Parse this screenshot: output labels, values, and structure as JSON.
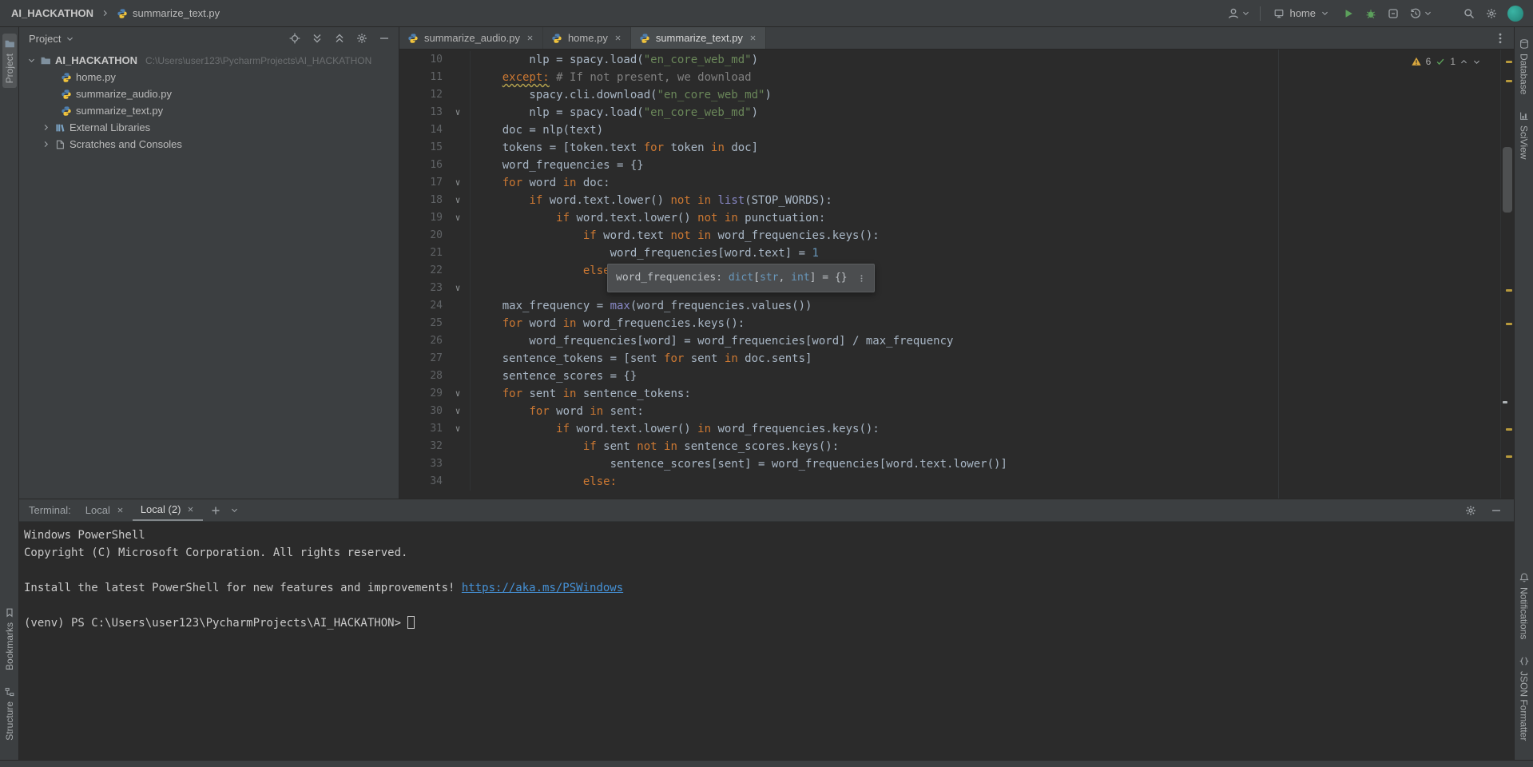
{
  "theme": {
    "editor_bg": "#2b2b2b",
    "panel_bg": "#3c3f41",
    "border": "#282828",
    "ui_text": "#bbbbbb",
    "code_text": "#a9b7c6",
    "keyword_orange": "#cc7832",
    "string_green": "#6a8759",
    "number_blue": "#6897bb",
    "comment_gray": "#808080",
    "builtin_purple": "#8888c6",
    "line_number_gray": "#606366",
    "run_green": "#5ca05c",
    "warning_yellow": "#d9a73e",
    "link_blue": "#4591d6",
    "avatar_teal": "#2e9e92"
  },
  "titlebar": {
    "project": "AI_HACKATHON",
    "file": "summarize_text.py",
    "run_config": "home"
  },
  "tool_strips": {
    "left_top": [
      "Project"
    ],
    "left_bottom": [
      "Bookmarks",
      "Structure"
    ],
    "right_top": [
      "Database",
      "SciView"
    ],
    "right_bottom": [
      "Notifications",
      "JSON Formatter"
    ]
  },
  "project_panel": {
    "header": "Project",
    "root_name": "AI_HACKATHON",
    "root_path": "C:\\Users\\user123\\PycharmProjects\\AI_HACKATHON",
    "files": [
      "home.py",
      "summarize_audio.py",
      "summarize_text.py"
    ],
    "nodes": [
      "External Libraries",
      "Scratches and Consoles"
    ]
  },
  "editor_tabs": [
    {
      "label": "summarize_audio.py"
    },
    {
      "label": "home.py"
    },
    {
      "label": "summarize_text.py"
    }
  ],
  "inspections": {
    "warnings": "6",
    "typos": "1"
  },
  "editor": {
    "tooltip": {
      "seg": [
        {
          "t": "word_frequencies: ",
          "c": "tp"
        },
        {
          "t": "dict",
          "c": "tb"
        },
        {
          "t": "[",
          "c": "tp"
        },
        {
          "t": "str",
          "c": "tb"
        },
        {
          "t": ", ",
          "c": "tp"
        },
        {
          "t": "int",
          "c": "tb"
        },
        {
          "t": "] = {}",
          "c": "tp"
        }
      ]
    },
    "lines": [
      {
        "no": "10",
        "fold": false,
        "seg": [
          {
            "t": "        nlp = spacy.load(",
            "c": "p"
          },
          {
            "t": "\"en_core_web_md\"",
            "c": "s"
          },
          {
            "t": ")",
            "c": "p"
          }
        ]
      },
      {
        "no": "11",
        "fold": false,
        "seg": [
          {
            "t": "    ",
            "c": "p"
          },
          {
            "t": "except:",
            "c": "e"
          },
          {
            "t": " ",
            "c": "p"
          },
          {
            "t": "# If not present, we download",
            "c": "c"
          }
        ]
      },
      {
        "no": "12",
        "fold": false,
        "seg": [
          {
            "t": "        spacy.cli.download(",
            "c": "p"
          },
          {
            "t": "\"en_core_web_md\"",
            "c": "s"
          },
          {
            "t": ")",
            "c": "p"
          }
        ]
      },
      {
        "no": "13",
        "fold": true,
        "seg": [
          {
            "t": "        nlp = spacy.load(",
            "c": "p"
          },
          {
            "t": "\"en_core_web_md\"",
            "c": "s"
          },
          {
            "t": ")",
            "c": "p"
          }
        ]
      },
      {
        "no": "14",
        "fold": false,
        "seg": [
          {
            "t": "    doc = nlp(text)",
            "c": "p"
          }
        ]
      },
      {
        "no": "15",
        "fold": false,
        "seg": [
          {
            "t": "    tokens = [token.text ",
            "c": "p"
          },
          {
            "t": "for",
            "c": "k"
          },
          {
            "t": " token ",
            "c": "p"
          },
          {
            "t": "in",
            "c": "k"
          },
          {
            "t": " doc]",
            "c": "p"
          }
        ]
      },
      {
        "no": "16",
        "fold": false,
        "seg": [
          {
            "t": "    word_frequencies = {}",
            "c": "p"
          }
        ]
      },
      {
        "no": "17",
        "fold": true,
        "seg": [
          {
            "t": "    ",
            "c": "p"
          },
          {
            "t": "for",
            "c": "k"
          },
          {
            "t": " word ",
            "c": "p"
          },
          {
            "t": "in",
            "c": "k"
          },
          {
            "t": " doc:",
            "c": "p"
          }
        ]
      },
      {
        "no": "18",
        "fold": true,
        "seg": [
          {
            "t": "        ",
            "c": "p"
          },
          {
            "t": "if",
            "c": "k"
          },
          {
            "t": " word.text.lower() ",
            "c": "p"
          },
          {
            "t": "not in",
            "c": "k"
          },
          {
            "t": " ",
            "c": "p"
          },
          {
            "t": "list",
            "c": "b"
          },
          {
            "t": "(STOP_WORDS):",
            "c": "p"
          }
        ]
      },
      {
        "no": "19",
        "fold": true,
        "seg": [
          {
            "t": "            ",
            "c": "p"
          },
          {
            "t": "if",
            "c": "k"
          },
          {
            "t": " word.text.lower() ",
            "c": "p"
          },
          {
            "t": "not in",
            "c": "k"
          },
          {
            "t": " punctuation:",
            "c": "p"
          }
        ]
      },
      {
        "no": "20",
        "fold": false,
        "seg": [
          {
            "t": "                ",
            "c": "p"
          },
          {
            "t": "if",
            "c": "k"
          },
          {
            "t": " word.text ",
            "c": "p"
          },
          {
            "t": "not in",
            "c": "k"
          },
          {
            "t": " word_frequencies.keys():",
            "c": "p"
          }
        ]
      },
      {
        "no": "21",
        "fold": false,
        "seg": [
          {
            "t": "                    word_frequencies[word.text] = ",
            "c": "p"
          },
          {
            "t": "1",
            "c": "n"
          }
        ]
      },
      {
        "no": "22",
        "fold": false,
        "seg": [
          {
            "t": "                ",
            "c": "p"
          },
          {
            "t": "else",
            "c": "k"
          }
        ]
      },
      {
        "no": "23",
        "fold": true,
        "seg": []
      },
      {
        "no": "24",
        "fold": false,
        "seg": [
          {
            "t": "    max_frequency = ",
            "c": "p"
          },
          {
            "t": "max",
            "c": "b"
          },
          {
            "t": "(word_frequencies.values())",
            "c": "p"
          }
        ]
      },
      {
        "no": "25",
        "fold": false,
        "seg": [
          {
            "t": "    ",
            "c": "p"
          },
          {
            "t": "for",
            "c": "k"
          },
          {
            "t": " word ",
            "c": "p"
          },
          {
            "t": "in",
            "c": "k"
          },
          {
            "t": " word_frequencies.keys():",
            "c": "p"
          }
        ]
      },
      {
        "no": "26",
        "fold": false,
        "seg": [
          {
            "t": "        word_frequencies[word] = word_frequencies[word] / max_frequency",
            "c": "p"
          }
        ]
      },
      {
        "no": "27",
        "fold": false,
        "seg": [
          {
            "t": "    sentence_tokens = [sent ",
            "c": "p"
          },
          {
            "t": "for",
            "c": "k"
          },
          {
            "t": " sent ",
            "c": "p"
          },
          {
            "t": "in",
            "c": "k"
          },
          {
            "t": " doc.sents]",
            "c": "p"
          }
        ]
      },
      {
        "no": "28",
        "fold": false,
        "seg": [
          {
            "t": "    sentence_scores = {}",
            "c": "p"
          }
        ]
      },
      {
        "no": "29",
        "fold": true,
        "seg": [
          {
            "t": "    ",
            "c": "p"
          },
          {
            "t": "for",
            "c": "k"
          },
          {
            "t": " sent ",
            "c": "p"
          },
          {
            "t": "in",
            "c": "k"
          },
          {
            "t": " sentence_tokens:",
            "c": "p"
          }
        ]
      },
      {
        "no": "30",
        "fold": true,
        "seg": [
          {
            "t": "        ",
            "c": "p"
          },
          {
            "t": "for",
            "c": "k"
          },
          {
            "t": " word ",
            "c": "p"
          },
          {
            "t": "in",
            "c": "k"
          },
          {
            "t": " sent:",
            "c": "p"
          }
        ]
      },
      {
        "no": "31",
        "fold": true,
        "seg": [
          {
            "t": "            ",
            "c": "p"
          },
          {
            "t": "if",
            "c": "k"
          },
          {
            "t": " word.text.lower() ",
            "c": "p"
          },
          {
            "t": "in",
            "c": "k"
          },
          {
            "t": " word_frequencies.keys():",
            "c": "p"
          }
        ]
      },
      {
        "no": "32",
        "fold": false,
        "seg": [
          {
            "t": "                ",
            "c": "p"
          },
          {
            "t": "if",
            "c": "k"
          },
          {
            "t": " sent ",
            "c": "p"
          },
          {
            "t": "not in",
            "c": "k"
          },
          {
            "t": " sentence_scores.keys():",
            "c": "p"
          }
        ]
      },
      {
        "no": "33",
        "fold": false,
        "seg": [
          {
            "t": "                    sentence_scores[sent] = word_frequencies[word.text.lower()]",
            "c": "p"
          }
        ]
      },
      {
        "no": "34",
        "fold": false,
        "seg": [
          {
            "t": "                ",
            "c": "p"
          },
          {
            "t": "else:",
            "c": "k"
          }
        ]
      }
    ]
  },
  "terminal": {
    "label": "Terminal:",
    "tabs": [
      {
        "label": "Local"
      },
      {
        "label": "Local (2)"
      }
    ],
    "banner1": "Windows PowerShell",
    "banner2": "Copyright (C) Microsoft Corporation. All rights reserved.",
    "install_msg": "Install the latest PowerShell for new features and improvements! ",
    "install_link": "https://aka.ms/PSWindows",
    "prompt": "(venv) PS C:\\Users\\user123\\PycharmProjects\\AI_HACKATHON>"
  }
}
